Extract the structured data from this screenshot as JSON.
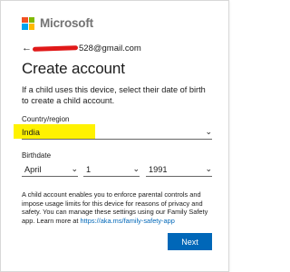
{
  "brand": {
    "name": "Microsoft",
    "logo_colors": [
      "#f25022",
      "#7fba00",
      "#00a4ef",
      "#ffb900"
    ]
  },
  "account": {
    "back_arrow": "←",
    "email_suffix": "528@gmail.com"
  },
  "page": {
    "title": "Create account",
    "intro": "If a child uses this device, select their date of birth to create a child account."
  },
  "country": {
    "label": "Country/region",
    "value": "India"
  },
  "birthdate": {
    "label": "Birthdate",
    "month": "April",
    "day": "1",
    "year": "1991"
  },
  "disclaimer": {
    "text": "A child account enables you to enforce parental controls and impose usage limits for this device for reasons of privacy and safety. You can manage these settings using our Family Safety app. Learn more at ",
    "link": "https://aka.ms/family-safety-app"
  },
  "actions": {
    "next_label": "Next"
  },
  "colors": {
    "accent": "#0067b8",
    "highlight": "#fff200",
    "redaction": "#e01919"
  }
}
